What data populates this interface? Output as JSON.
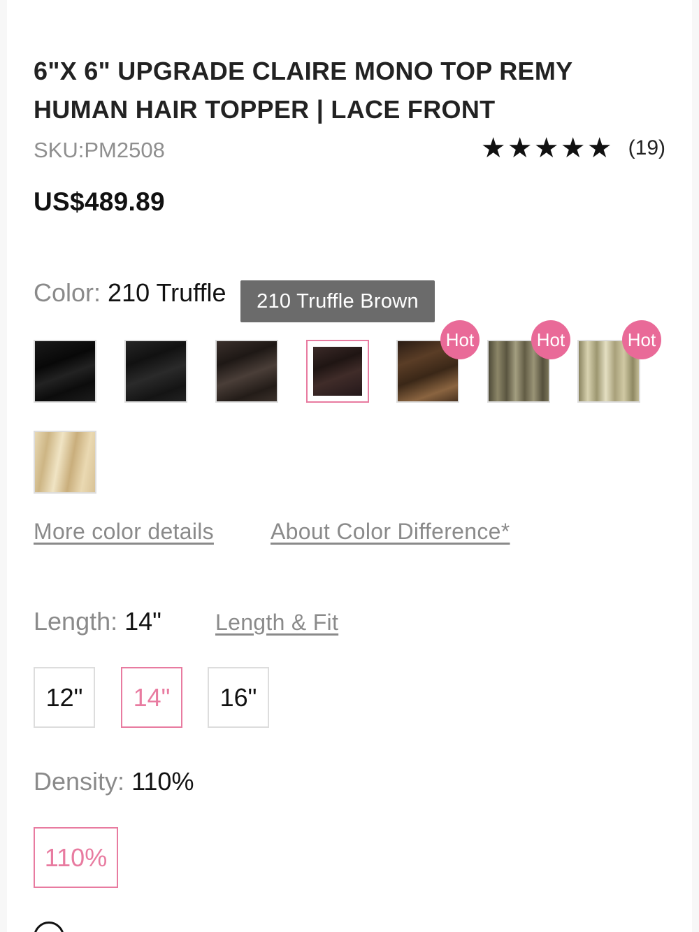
{
  "product": {
    "title_line1": "6\"X 6\" UPGRADE CLAIRE MONO TOP REMY",
    "title_line2": "HUMAN HAIR TOPPER | LACE FRONT",
    "sku": "SKU:PM2508",
    "rating_stars": 5,
    "rating_count": "(19)",
    "price": "US$489.89"
  },
  "color": {
    "label": "Color:",
    "value": "210 Truffle",
    "tooltip": "210 Truffle Brown",
    "swatches": [
      {
        "name": "jet-black",
        "hot": false,
        "selected": false
      },
      {
        "name": "off-black",
        "hot": false,
        "selected": false
      },
      {
        "name": "dark-brown",
        "hot": false,
        "selected": false
      },
      {
        "name": "210-truffle-brown",
        "hot": false,
        "selected": true
      },
      {
        "name": "balayage-brown",
        "hot": true,
        "selected": false
      },
      {
        "name": "ash-highlight",
        "hot": true,
        "selected": false
      },
      {
        "name": "blonde-highlight",
        "hot": true,
        "selected": false
      },
      {
        "name": "light-blonde",
        "hot": false,
        "selected": false
      }
    ],
    "hot_label": "Hot",
    "more_details_link": "More color details",
    "about_difference_link": "About Color Difference*"
  },
  "length": {
    "label": "Length:",
    "value": "14\"",
    "fit_link": "Length & Fit",
    "options": [
      "12\"",
      "14\"",
      "16\""
    ],
    "selected": "14\""
  },
  "density": {
    "label": "Density:",
    "value": "110%",
    "options": [
      "110%"
    ]
  },
  "colors": {
    "accent": "#e87ba0",
    "hot_badge": "#e96a98",
    "tooltip_bg": "#6b6b6b",
    "muted_text": "#8a8a8a"
  },
  "icons": {
    "rating": "star-icon",
    "processing": "clock-icon"
  }
}
